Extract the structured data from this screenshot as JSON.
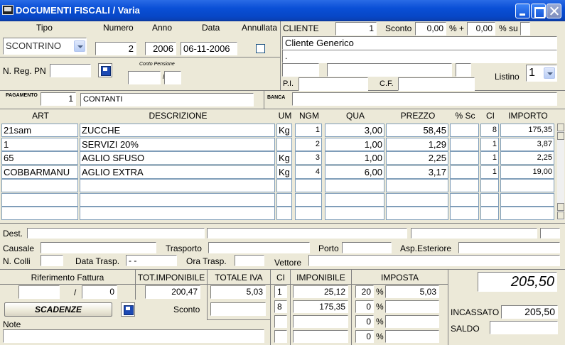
{
  "window": {
    "title": "DOCUMENTI FISCALI / Varia"
  },
  "header": {
    "labels": {
      "tipo": "Tipo",
      "numero": "Numero",
      "anno": "Anno",
      "data": "Data",
      "annullata": "Annullata"
    },
    "tipo_value": "SCONTRINO",
    "numero_value": "2",
    "anno_value": "2006",
    "data_value": "06-11-2006",
    "nreg_label": "N. Reg. PN",
    "nreg_value": "",
    "conto_pensione_label": "Conto Pensione",
    "conto_pensione_sep": "/"
  },
  "cliente": {
    "label": "CLIENTE",
    "code": "1",
    "sconto_label": "Sconto",
    "sconto1": "0,00",
    "pct_plus": "% +",
    "sconto2": "0,00",
    "pct_su": "% su",
    "name": "Cliente Generico",
    "address": ".",
    "piva_label": "P.I.",
    "cf_label": "C.F.",
    "listino_label": "Listino",
    "listino_value": "1"
  },
  "pagamento": {
    "label": "PAGAMENTO",
    "code": "1",
    "desc": "CONTANTI",
    "banca_label": "BANCA"
  },
  "table": {
    "headers": [
      "ART",
      "DESCRIZIONE",
      "UM",
      "NGM",
      "QUA",
      "PREZZO",
      "% Sc",
      "CI",
      "IMPORTO"
    ],
    "rows": [
      {
        "art": "21sam",
        "desc": "ZUCCHE",
        "um": "Kg",
        "ngm": "1",
        "qua": "3,00",
        "prezzo": "58,45",
        "sc": "",
        "ci": "8",
        "importo": "175,35"
      },
      {
        "art": "1",
        "desc": "SERVIZI 20%",
        "um": "",
        "ngm": "2",
        "qua": "1,00",
        "prezzo": "1,29",
        "sc": "",
        "ci": "1",
        "importo": "3,87"
      },
      {
        "art": "65",
        "desc": "AGLIO SFUSO",
        "um": "Kg",
        "ngm": "3",
        "qua": "1,00",
        "prezzo": "2,25",
        "sc": "",
        "ci": "1",
        "importo": "2,25"
      },
      {
        "art": "COBBARMANU",
        "desc": "AGLIO EXTRA",
        "um": "Kg",
        "ngm": "4",
        "qua": "6,00",
        "prezzo": "3,17",
        "sc": "",
        "ci": "1",
        "importo": "19,00"
      },
      {
        "art": "",
        "desc": "",
        "um": "",
        "ngm": "",
        "qua": "",
        "prezzo": "",
        "sc": "",
        "ci": "",
        "importo": ""
      },
      {
        "art": "",
        "desc": "",
        "um": "",
        "ngm": "",
        "qua": "",
        "prezzo": "",
        "sc": "",
        "ci": "",
        "importo": ""
      },
      {
        "art": "",
        "desc": "",
        "um": "",
        "ngm": "",
        "qua": "",
        "prezzo": "",
        "sc": "",
        "ci": "",
        "importo": ""
      }
    ]
  },
  "shipping": {
    "dest_label": "Dest.",
    "causale_label": "Causale",
    "trasporto_label": "Trasporto",
    "porto_label": "Porto",
    "asp_label": "Asp.Esteriore",
    "ncolli_label": "N. Colli",
    "data_trasp_label": "Data Trasp.",
    "data_trasp_value": "- -",
    "ora_trasp_label": "Ora Trasp.",
    "vettore_label": "Vettore"
  },
  "totals": {
    "rif_fattura_label": "Riferimento Fattura",
    "rif_sep": "/",
    "rif_value": "0",
    "tot_imponibile_label": "TOT.IMPONIBILE",
    "tot_imponibile": "200,47",
    "totale_iva_label": "TOTALE IVA",
    "totale_iva": "5,03",
    "ci_label": "CI",
    "imponibile_label": "IMPONIBILE",
    "imposta_label": "IMPOSTA",
    "vat": [
      {
        "ci": "1",
        "imponibile": "25,12",
        "pct": "20",
        "imposta": "5,03"
      },
      {
        "ci": "8",
        "imponibile": "175,35",
        "pct": "0",
        "imposta": ""
      },
      {
        "ci": "",
        "imponibile": "",
        "pct": "0",
        "imposta": ""
      },
      {
        "ci": "",
        "imponibile": "",
        "pct": "0",
        "imposta": ""
      }
    ],
    "pct_sign": "%",
    "grand_total": "205,50",
    "incassato_label": "INCASSATO",
    "incassato": "205,50",
    "saldo_label": "SALDO",
    "saldo": "",
    "scadenze_label": "SCADENZE",
    "sconto_label": "Sconto",
    "note_label": "Note"
  }
}
